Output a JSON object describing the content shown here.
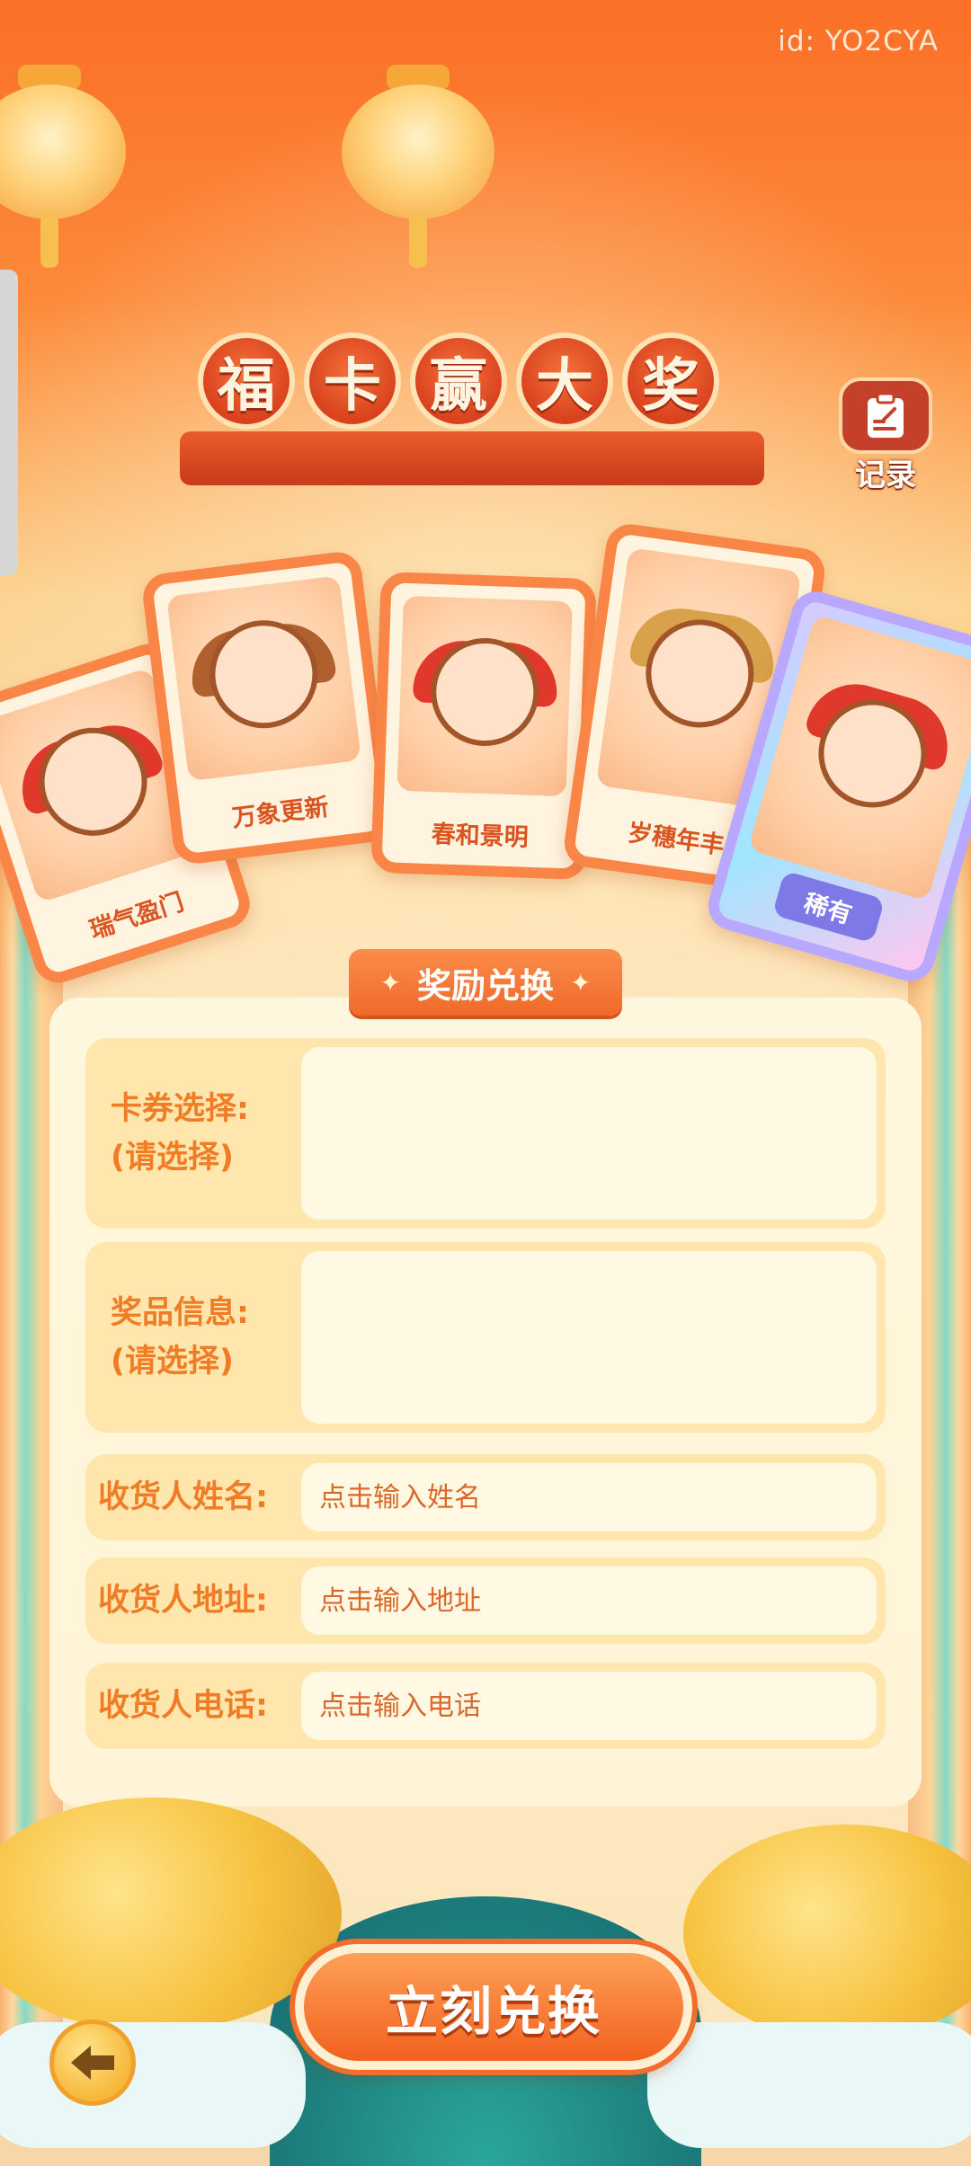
{
  "header": {
    "user_id": "id: YO2CYA",
    "title_chars": [
      "福",
      "卡",
      "赢",
      "大",
      "奖"
    ],
    "record_label": "记录"
  },
  "cards": [
    {
      "name": "瑞气盈门"
    },
    {
      "name": "万象更新"
    },
    {
      "name": "春和景明"
    },
    {
      "name": "岁穗年丰"
    },
    {
      "name": "稀有"
    }
  ],
  "redeem_section": {
    "title": "奖励兑换",
    "card_select_label": "卡券选择:",
    "card_select_hint": "(请选择)",
    "prize_info_label": "奖品信息:",
    "prize_info_hint": "(请选择)",
    "name_label": "收货人姓名:",
    "name_placeholder": "点击输入姓名",
    "address_label": "收货人地址:",
    "address_placeholder": "点击输入地址",
    "phone_label": "收货人电话:",
    "phone_placeholder": "点击输入电话"
  },
  "actions": {
    "redeem_button": "立刻兑换"
  },
  "colors": {
    "accent": "#f07c25",
    "header_orange": "#fb6f27",
    "rare_badge": "#7f79e8"
  },
  "icons": [
    "record-icon",
    "back-arrow-icon",
    "sparkle-icon"
  ]
}
